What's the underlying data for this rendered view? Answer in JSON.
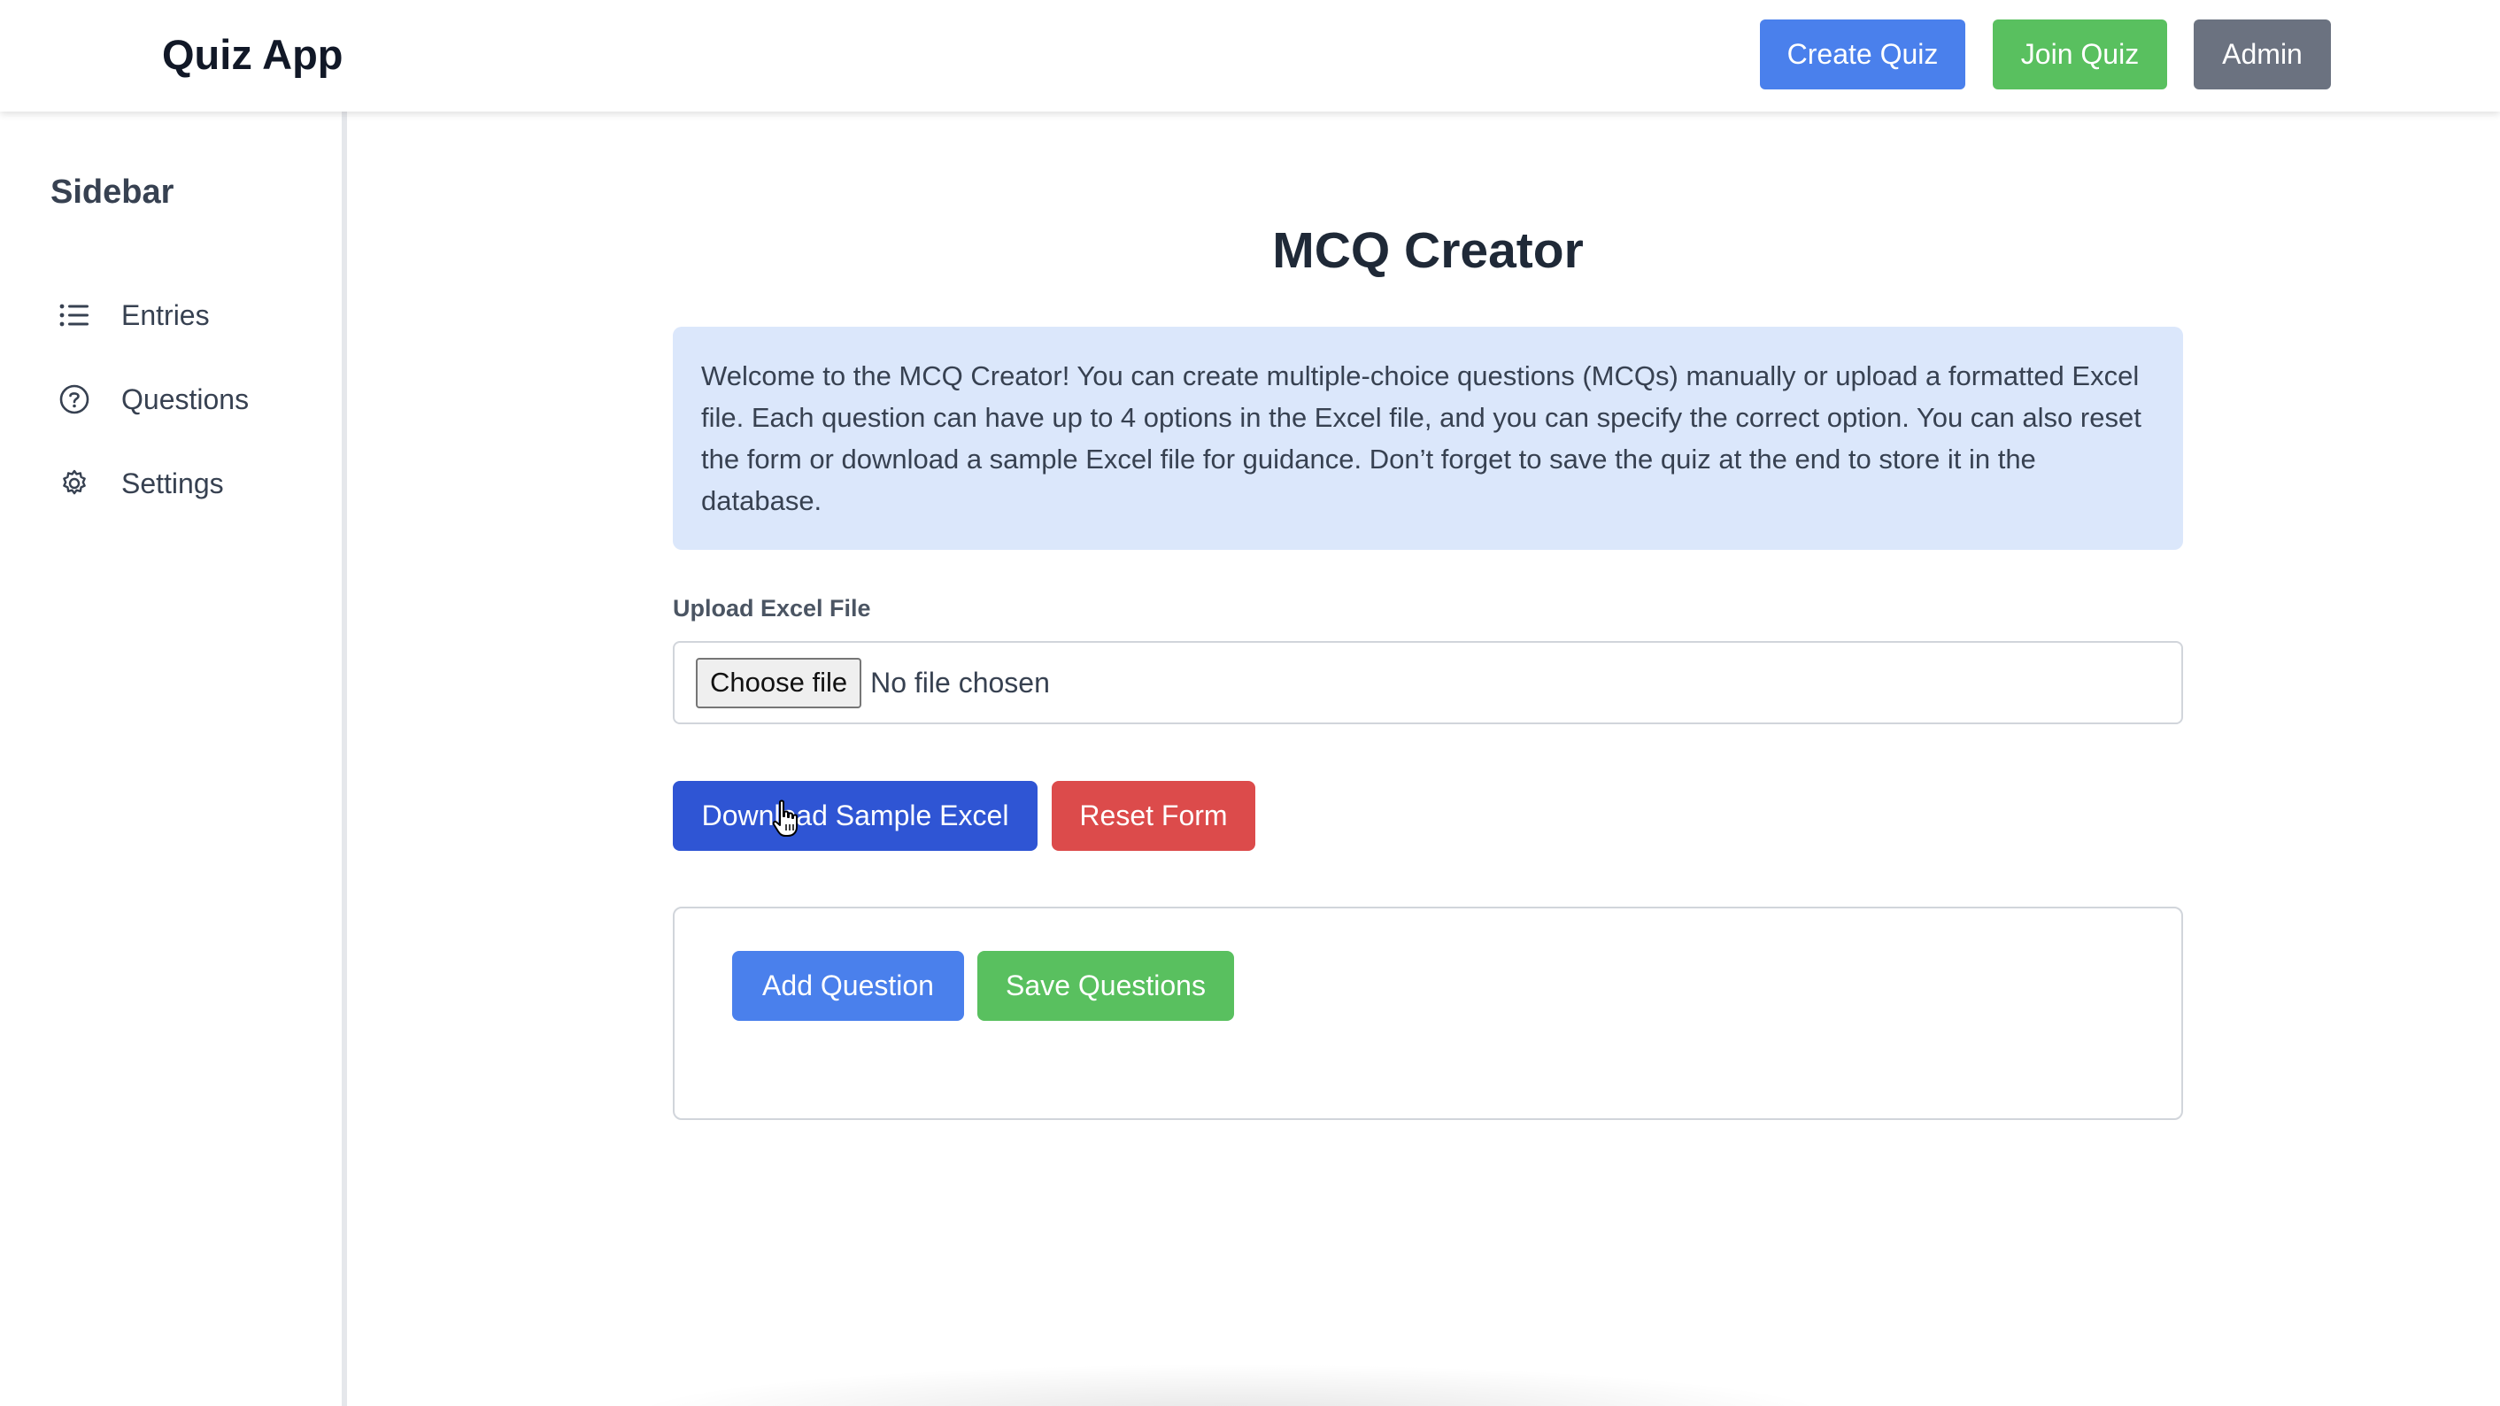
{
  "header": {
    "brand": "Quiz App",
    "buttons": {
      "create": "Create Quiz",
      "join": "Join Quiz",
      "admin": "Admin"
    }
  },
  "sidebar": {
    "title": "Sidebar",
    "items": [
      {
        "label": "Entries",
        "icon": "list-icon"
      },
      {
        "label": "Questions",
        "icon": "question-circle-icon"
      },
      {
        "label": "Settings",
        "icon": "gear-icon"
      }
    ]
  },
  "main": {
    "title": "MCQ Creator",
    "info": "Welcome to the MCQ Creator! You can create multiple-choice questions (MCQs) manually or upload a formatted Excel file. Each question can have up to 4 options in the Excel file, and you can specify the correct option. You can also reset the form or download a sample Excel file for guidance. Don’t forget to save the quiz at the end to store it in the database.",
    "upload": {
      "label": "Upload Excel File",
      "choose_button": "Choose file",
      "status": "No file chosen"
    },
    "actions": {
      "download": "Download Sample Excel",
      "reset": "Reset Form"
    },
    "questions_panel": {
      "add": "Add Question",
      "save": "Save Questions"
    }
  },
  "colors": {
    "primary_blue": "#4a80ec",
    "download_blue": "#2f55d4",
    "green": "#59c05f",
    "red": "#dc4b4b",
    "gray": "#6b7280",
    "info_bg": "#dbe7fb"
  }
}
